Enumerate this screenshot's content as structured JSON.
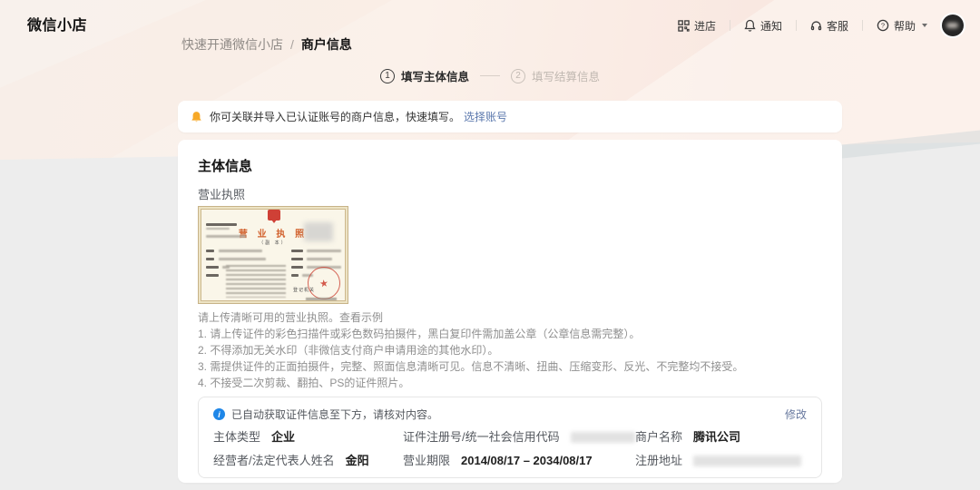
{
  "header": {
    "logo": "微信小店",
    "breadcrumb": {
      "parent": "快速开通微信小店",
      "separator": "/",
      "current": "商户信息"
    },
    "actions": [
      {
        "icon": "qr-code-icon",
        "label": "进店"
      },
      {
        "icon": "bell-icon",
        "label": "通知"
      },
      {
        "icon": "headset-icon",
        "label": "客服"
      },
      {
        "icon": "question-icon",
        "label": "帮助"
      }
    ]
  },
  "steps": {
    "items": [
      {
        "number": "1",
        "label": "填写主体信息",
        "active": true
      },
      {
        "number": "2",
        "label": "填写结算信息",
        "active": false
      }
    ]
  },
  "notice": {
    "text": "你可关联并导入已认证账号的商户信息，快速填写。",
    "link": "选择账号"
  },
  "main": {
    "title": "主体信息",
    "license_label": "营业执照",
    "license": {
      "title": "营 业 执 照",
      "subtitle": "（副 本）",
      "authority": "登记机关",
      "seal": "★"
    },
    "tips_intro_text": "请上传清晰可用的营业执照。",
    "tips_intro_link": "查看示例",
    "tips": [
      "1. 请上传证件的彩色扫描件或彩色数码拍摄件，黑白复印件需加盖公章（公章信息需完整）。",
      "2. 不得添加无关水印（非微信支付商户申请用途的其他水印）。",
      "3. 需提供证件的正面拍摄件，完整、照面信息清晰可见。信息不清晰、扭曲、压缩变形、反光、不完整均不接受。",
      "4. 不接受二次剪裁、翻拍、PS的证件照片。"
    ],
    "panel": {
      "notice": "已自动获取证件信息至下方，请核对内容。",
      "edit_link": "修改",
      "fields": [
        {
          "label": "主体类型",
          "value": "企业",
          "redacted": false
        },
        {
          "label": "证件注册号/统一社会信用代码",
          "value": "",
          "redacted": true
        },
        {
          "label": "商户名称",
          "value": "腾讯公司",
          "redacted": false
        },
        {
          "label": "经营者/法定代表人姓名",
          "value": "金阳",
          "redacted": false
        },
        {
          "label": "营业期限",
          "value": "2014/08/17 – 2034/08/17",
          "redacted": false
        },
        {
          "label": "注册地址",
          "value": "",
          "redacted": true
        }
      ]
    }
  },
  "colors": {
    "link_blue": "#5b78ad",
    "info_blue": "#1f87e8",
    "warning_yellow": "#f7a928",
    "seal_red": "#cc3e30",
    "band_pink": "#f9e8e1",
    "page_gray": "#ededed"
  }
}
